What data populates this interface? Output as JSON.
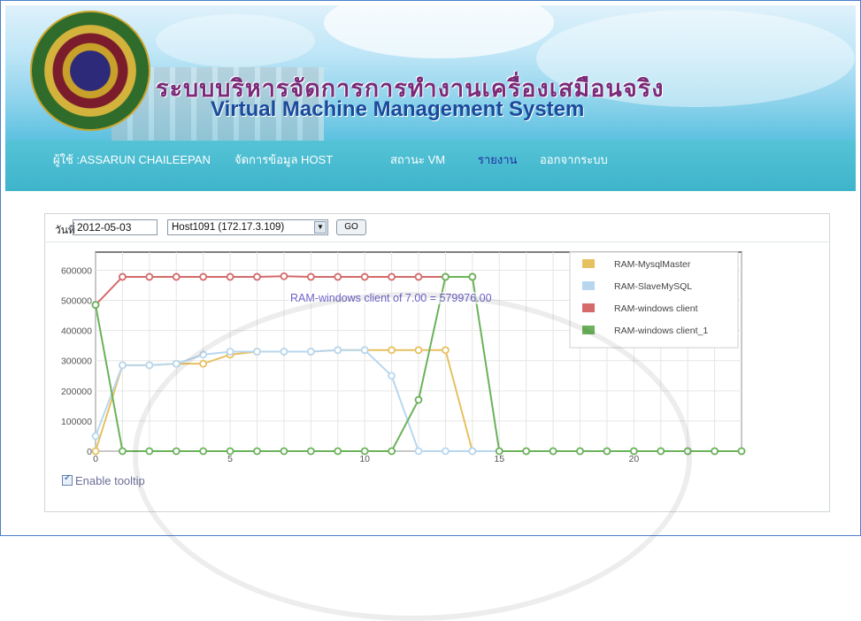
{
  "header": {
    "title_th": "ระบบบริหารจัดการการทำงานเครื่องเสมือนจริง",
    "title_en": "Virtual Machine Management System",
    "logo_icon": "university-seal-icon"
  },
  "nav": {
    "user": "ผู้ใช้ :ASSARUN CHAILEEPAN",
    "items": [
      "จัดการข้อมูล HOST",
      "สถานะ VM",
      "รายงาน",
      "ออกจากระบบ"
    ],
    "active": "รายงาน"
  },
  "filters": {
    "date_label": "วันที่",
    "date_value": "2012-05-03",
    "host_value": "Host1091 (172.17.3.109)",
    "go_label": "GO"
  },
  "tooltip": {
    "text": "RAM-windows client of 7.00 = 579976.00"
  },
  "enable_tooltip": {
    "label": "Enable tooltip",
    "checked": true
  },
  "colors": {
    "mysqlmaster": "#e6c160",
    "slavemysql": "#b8d7ef",
    "windows_client": "#d46a6a",
    "windows_client_1": "#6bb25a"
  },
  "chart_data": {
    "type": "line",
    "x": [
      0,
      1,
      2,
      3,
      4,
      5,
      6,
      7,
      8,
      9,
      10,
      11,
      12,
      13,
      14,
      15,
      16,
      17,
      18,
      19,
      20,
      21,
      22,
      23,
      24
    ],
    "xticks": [
      0,
      5,
      10,
      15,
      20
    ],
    "yticks": [
      0,
      100000,
      200000,
      300000,
      400000,
      500000,
      600000
    ],
    "ylim": [
      0,
      660000
    ],
    "xlim": [
      0,
      24
    ],
    "grid": true,
    "legend_position": "top-right",
    "series": [
      {
        "name": "RAM-MysqlMaster",
        "color_key": "mysqlmaster",
        "values": [
          0,
          285000,
          285000,
          290000,
          290000,
          320000,
          330000,
          330000,
          330000,
          335000,
          335000,
          335000,
          335000,
          335000,
          0,
          0,
          0,
          0,
          0,
          0,
          0,
          0,
          0,
          0,
          0
        ]
      },
      {
        "name": "RAM-SlaveMySQL",
        "color_key": "slavemysql",
        "values": [
          50000,
          285000,
          285000,
          290000,
          320000,
          330000,
          330000,
          330000,
          330000,
          335000,
          335000,
          250000,
          0,
          0,
          0,
          0,
          0,
          0,
          0,
          0,
          0,
          0,
          0,
          0,
          0
        ]
      },
      {
        "name": "RAM-windows client",
        "color_key": "windows_client",
        "values": [
          485000,
          578000,
          578000,
          578000,
          578000,
          578000,
          578000,
          579976,
          578000,
          578000,
          578000,
          578000,
          578000,
          578000,
          578000,
          null,
          null,
          null,
          null,
          null,
          null,
          null,
          null,
          null,
          null
        ]
      },
      {
        "name": "RAM-windows client_1",
        "color_key": "windows_client_1",
        "values": [
          485000,
          0,
          0,
          0,
          0,
          0,
          0,
          0,
          0,
          0,
          0,
          0,
          170000,
          578000,
          578000,
          0,
          0,
          0,
          0,
          0,
          0,
          0,
          0,
          0,
          0
        ]
      }
    ]
  }
}
